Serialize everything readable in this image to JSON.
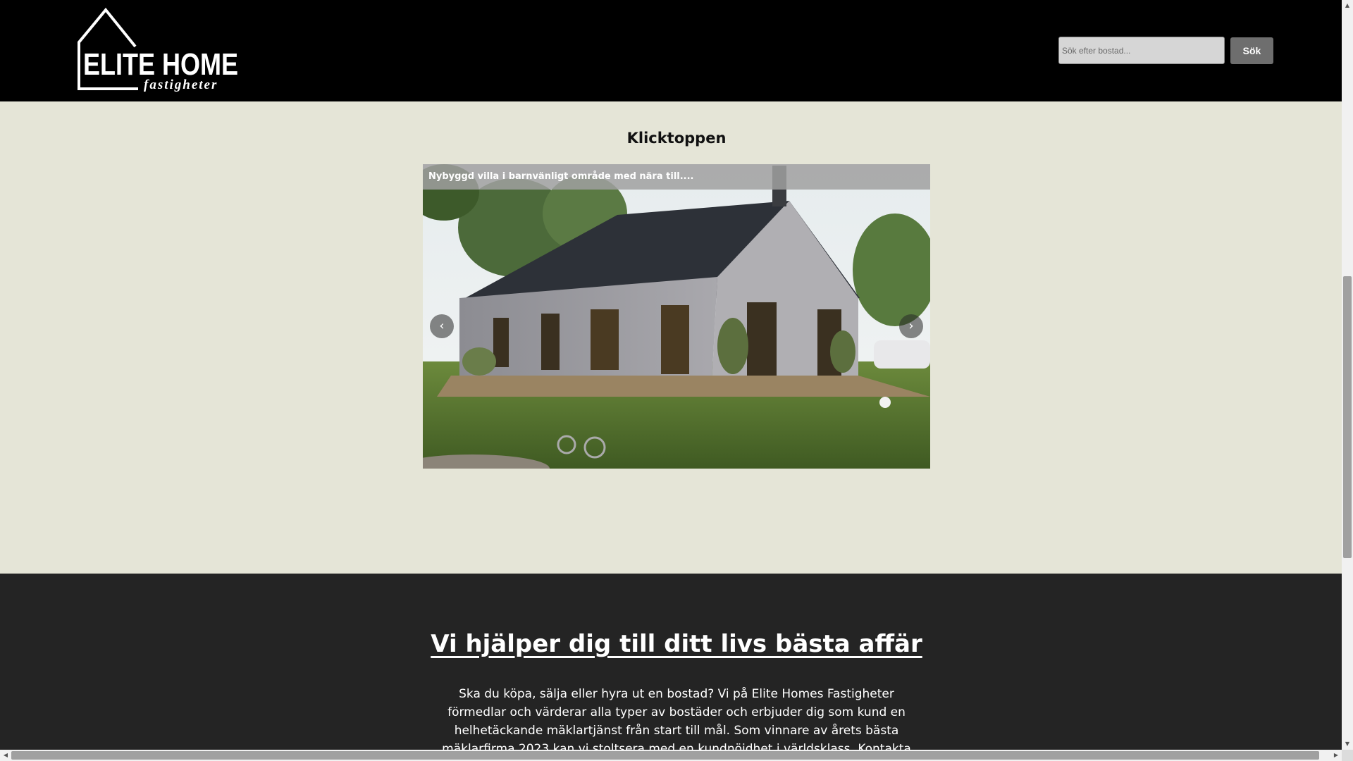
{
  "header": {
    "logo": {
      "text_main": "ELITE HOME",
      "text_sub": "fastigheter"
    },
    "search": {
      "placeholder": "Sök efter bostad...",
      "button_label": "Sök"
    }
  },
  "featured": {
    "title": "Klicktoppen",
    "slide": {
      "caption": "Nybyggd villa i barnvänligt område med nära till...."
    },
    "prev_icon": "‹",
    "next_icon": "›",
    "dot_count": 7,
    "active_dot": 6
  },
  "about": {
    "title": "Vi hjälper dig till ditt livs bästa affär",
    "text": "Ska du köpa, sälja eller hyra ut en bostad? Vi på Elite Homes Fastigheter förmedlar och värderar alla typer av bostäder och erbjuder dig som kund en helhetäckande mäklartjänst från start till mål. Som vinnare av årets bästa mäklarfirma 2023 kan vi stoltsera med en kundnöjdhet i världsklass. Kontakta någon av våra enastående mäklare nedan!"
  },
  "colors": {
    "header_bg": "#000000",
    "featured_bg": "#e5e5d7",
    "about_bg": "#242424"
  }
}
